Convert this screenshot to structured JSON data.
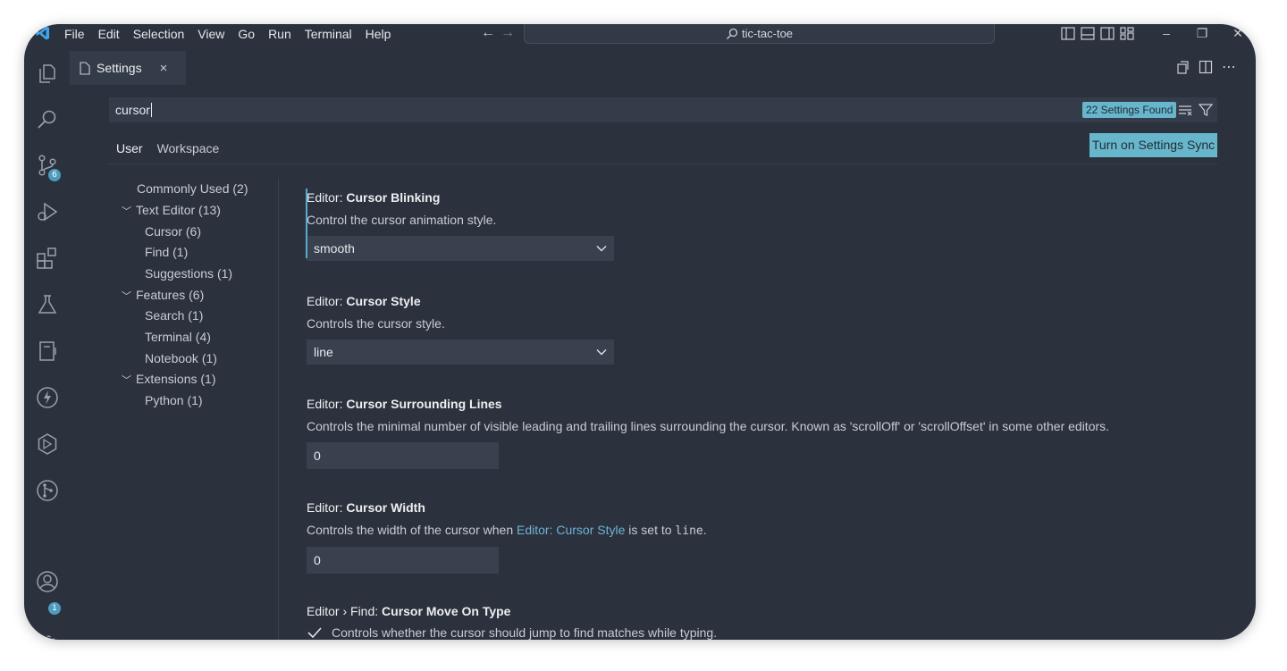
{
  "menu": [
    "File",
    "Edit",
    "Selection",
    "View",
    "Go",
    "Run",
    "Terminal",
    "Help"
  ],
  "command_center": {
    "text": "tic-tac-toe"
  },
  "activity": {
    "source_control_badge": "6",
    "accounts_badge": "1"
  },
  "tab": {
    "label": "Settings",
    "close": "×"
  },
  "search": {
    "value": "cursor",
    "results_count": "22 Settings Found"
  },
  "scopes": {
    "user": "User",
    "workspace": "Workspace"
  },
  "sync_button": "Turn on Settings Sync",
  "toc": [
    {
      "label": "Commonly Used (2)",
      "expandable": false,
      "level": 0
    },
    {
      "label": "Text Editor (13)",
      "expandable": true,
      "level": 0
    },
    {
      "label": "Cursor (6)",
      "expandable": false,
      "level": 1
    },
    {
      "label": "Find (1)",
      "expandable": false,
      "level": 1
    },
    {
      "label": "Suggestions (1)",
      "expandable": false,
      "level": 1
    },
    {
      "label": "Features (6)",
      "expandable": true,
      "level": 0
    },
    {
      "label": "Search (1)",
      "expandable": false,
      "level": 1
    },
    {
      "label": "Terminal (4)",
      "expandable": false,
      "level": 1
    },
    {
      "label": "Notebook (1)",
      "expandable": false,
      "level": 1
    },
    {
      "label": "Extensions (1)",
      "expandable": true,
      "level": 0
    },
    {
      "label": "Python (1)",
      "expandable": false,
      "level": 1
    }
  ],
  "settings": {
    "blinking": {
      "category": "Editor: ",
      "name": "Cursor Blinking",
      "desc": "Control the cursor animation style.",
      "value": "smooth"
    },
    "style": {
      "category": "Editor: ",
      "name": "Cursor Style",
      "desc": "Controls the cursor style.",
      "value": "line"
    },
    "surrounding": {
      "category": "Editor: ",
      "name": "Cursor Surrounding Lines",
      "desc": "Controls the minimal number of visible leading and trailing lines surrounding the cursor. Known as 'scrollOff' or 'scrollOffset' in some other editors.",
      "value": "0"
    },
    "width": {
      "category": "Editor: ",
      "name": "Cursor Width",
      "desc_pre": "Controls the width of the cursor when ",
      "desc_link": "Editor: Cursor Style",
      "desc_mid": " is set to ",
      "desc_code": "line",
      "desc_post": ".",
      "value": "0"
    },
    "find": {
      "category": "Editor › Find: ",
      "name": "Cursor Move On Type",
      "desc": "Controls whether the cursor should jump to find matches while typing."
    }
  },
  "colors": {
    "background": "#2b313d",
    "accent": "#68b6cc",
    "input": "#353c49"
  }
}
